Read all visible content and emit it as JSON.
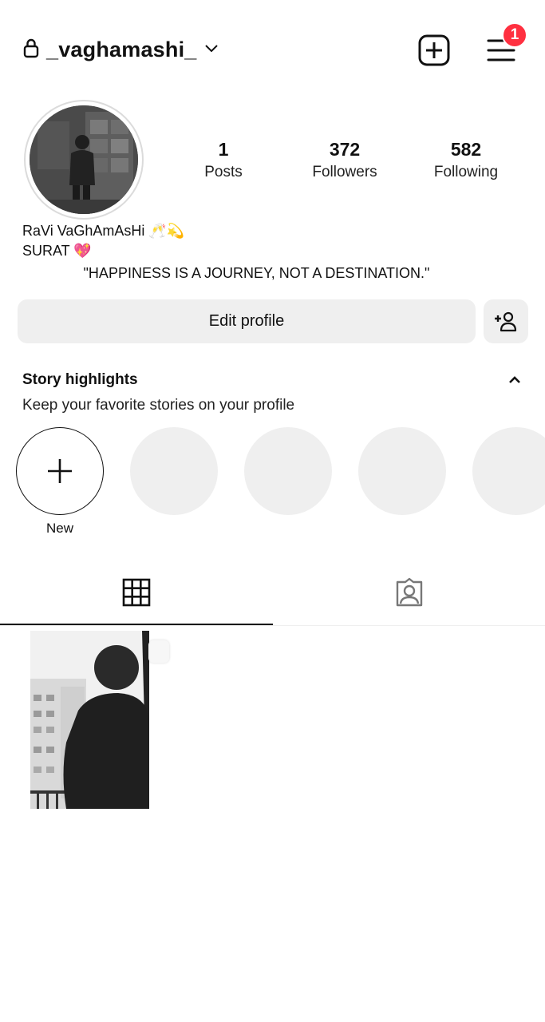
{
  "header": {
    "username": "_vaghamashi_",
    "notification_count": "1"
  },
  "stats": [
    {
      "value": "1",
      "label": "Posts"
    },
    {
      "value": "372",
      "label": "Followers"
    },
    {
      "value": "582",
      "label": "Following"
    }
  ],
  "bio": {
    "name": "RaVi VaGhAmAsHi 🥂💫",
    "city": "SURAT 💖",
    "quote": "\"HAPPINESS IS A JOURNEY, NOT A DESTINATION.\""
  },
  "actions": {
    "edit_profile_label": "Edit profile"
  },
  "highlights": {
    "title": "Story highlights",
    "subtitle": "Keep your favorite stories on your profile",
    "new_label": "New"
  },
  "colors": {
    "badge": "#ff3040",
    "button_bg": "#efefef"
  }
}
